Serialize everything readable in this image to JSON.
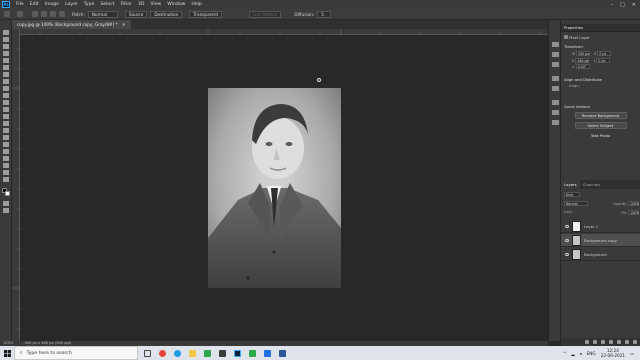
{
  "app": {
    "logo": "Ps",
    "menu": [
      "File",
      "Edit",
      "Image",
      "Layer",
      "Type",
      "Select",
      "Filter",
      "3D",
      "View",
      "Window",
      "Help"
    ],
    "window_controls": [
      "–",
      "□",
      "✕"
    ]
  },
  "options_bar": {
    "patch_label": "Patch:",
    "patch_mode": "Normal",
    "source": "Source",
    "destination": "Destination",
    "transparent": "Transparent",
    "use_pattern": "Use Pattern",
    "diffusion_label": "Diffusion:",
    "diffusion_value": "5"
  },
  "document": {
    "tab_title": "copy.jpg @ 100% (Background copy, Gray/8#) *",
    "zoom": "100%",
    "doc_info": "340 px x 480 px (300 ppi)",
    "accent": "#31a8ff"
  },
  "properties": {
    "tab": "Properties",
    "type": "Pixel Layer",
    "transform_title": "Transform",
    "w": "340 px",
    "h": "480 px",
    "x": "0 px",
    "y": "0 px",
    "angle": "0.00°",
    "align_title": "Align and Distribute",
    "align_label": "Align:",
    "quick_actions_title": "Quick Actions",
    "quick_actions": [
      "Remove Background",
      "Select Subject",
      "Take Photo"
    ]
  },
  "layers_panel": {
    "tabs": [
      "Layers",
      "Channels"
    ],
    "kind_label": "Kind",
    "blend_mode": "Normal",
    "opacity_label": "Opacity:",
    "opacity": "100%",
    "lock_label": "Lock:",
    "fill_label": "Fill:",
    "fill": "100%",
    "layers": [
      {
        "name": "Layer 1",
        "selected": false,
        "thumb": "white"
      },
      {
        "name": "Background copy",
        "selected": true,
        "thumb": "photo"
      },
      {
        "name": "Background",
        "selected": false,
        "thumb": "photo"
      }
    ]
  },
  "taskbar": {
    "search_placeholder": "Type here to search",
    "apps": [
      {
        "name": "task-view",
        "color": "#444444"
      },
      {
        "name": "chrome",
        "color": "#e8453c"
      },
      {
        "name": "edge",
        "color": "#1b9de2"
      },
      {
        "name": "file-explorer",
        "color": "#f2c744"
      },
      {
        "name": "paint",
        "color": "#2ea44f"
      },
      {
        "name": "store",
        "color": "#3b3b3b"
      },
      {
        "name": "photoshop",
        "color": "#001e36"
      },
      {
        "name": "camtasia",
        "color": "#2aa84a"
      },
      {
        "name": "mail",
        "color": "#1f6feb"
      },
      {
        "name": "word",
        "color": "#2b579a"
      }
    ],
    "language": "ENG",
    "time": "12:24",
    "date": "22-06-2021"
  }
}
